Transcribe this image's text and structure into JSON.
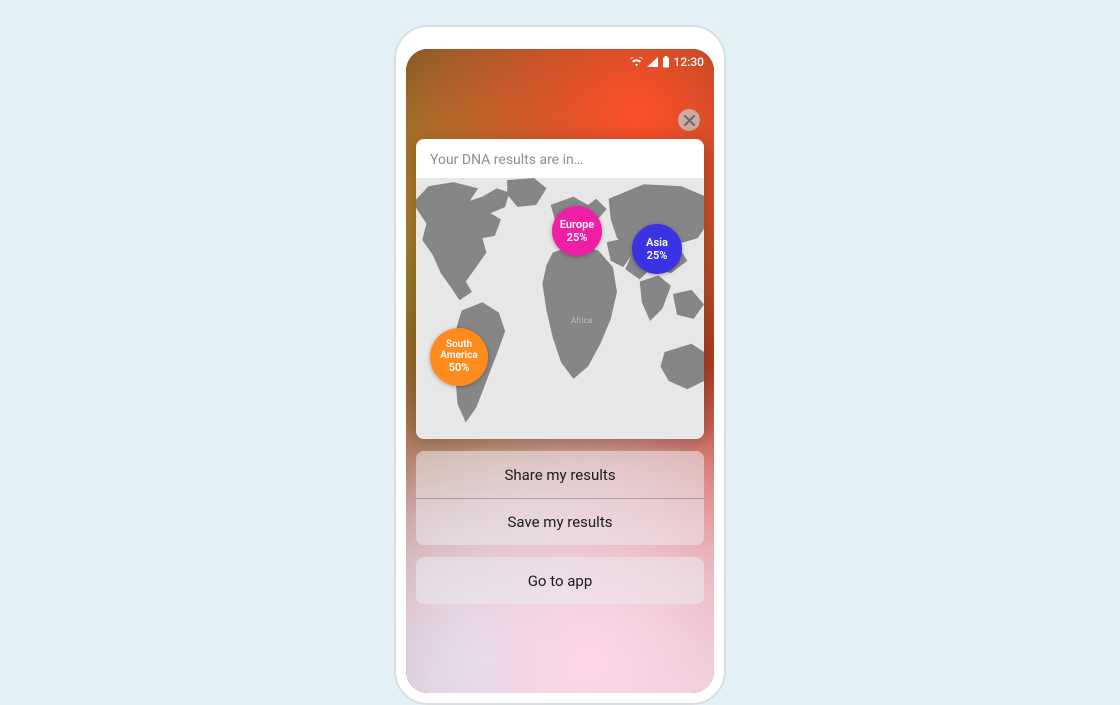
{
  "statusbar": {
    "time": "12:30"
  },
  "close_label": "×",
  "card": {
    "title": "Your DNA results are in…",
    "map": {
      "africa_label": "Africa",
      "bubbles": {
        "south_america": {
          "region": "South\nAmerica",
          "pct": "50%"
        },
        "europe": {
          "region": "Europe",
          "pct": "25%"
        },
        "asia": {
          "region": "Asia",
          "pct": "25%"
        }
      }
    }
  },
  "actions": {
    "share": "Share my results",
    "save": "Save my results",
    "goto": "Go to app"
  },
  "chart_data": {
    "type": "pie",
    "title": "Your DNA results are in…",
    "categories": [
      "South America",
      "Europe",
      "Asia"
    ],
    "values": [
      50,
      25,
      25
    ],
    "colors": [
      "#ff8a1e",
      "#ef1fa5",
      "#3a33e6"
    ]
  }
}
